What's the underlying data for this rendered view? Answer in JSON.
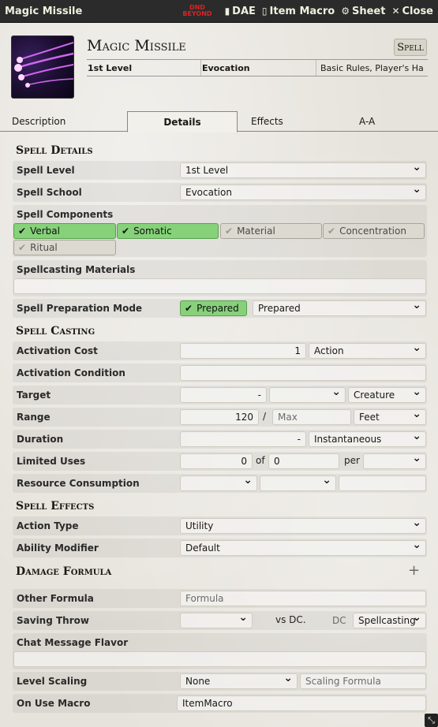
{
  "window": {
    "title": "Magic Missile",
    "ddb_line1": "DND",
    "ddb_line2": "BEYOND",
    "dae_label": "DAE",
    "item_macro_label": "Item Macro",
    "sheet_label": "Sheet",
    "close_label": "Close"
  },
  "header": {
    "name": "Magic Missile",
    "type_badge": "Spell",
    "level": "1st Level",
    "school": "Evocation",
    "source": "Basic Rules, Player's Ha"
  },
  "tabs": [
    {
      "label": "Description"
    },
    {
      "label": "Details"
    },
    {
      "label": "Effects"
    },
    {
      "label": "A-A"
    }
  ],
  "details": {
    "h_spell_details": "Spell Details",
    "spell_level_label": "Spell Level",
    "spell_level_value": "1st Level",
    "spell_school_label": "Spell School",
    "spell_school_value": "Evocation",
    "components_label": "Spell Components",
    "components": {
      "verbal": "Verbal",
      "somatic": "Somatic",
      "material": "Material",
      "concentration": "Concentration",
      "ritual": "Ritual"
    },
    "materials_label": "Spellcasting Materials",
    "materials_value": "",
    "prep_label": "Spell Preparation Mode",
    "prep_check": "Prepared",
    "prep_mode": "Prepared",
    "h_spell_casting": "Spell Casting",
    "activation_cost_label": "Activation Cost",
    "activation_cost_value": "1",
    "activation_type": "Action",
    "activation_condition_label": "Activation Condition",
    "activation_condition_value": "",
    "target_label": "Target",
    "target_value": "-",
    "target_units": "",
    "target_type": "Creature",
    "range_label": "Range",
    "range_value": "120",
    "range_sep": "/",
    "range_max_placeholder": "Max",
    "range_units": "Feet",
    "duration_label": "Duration",
    "duration_value": "-",
    "duration_units": "Instantaneous",
    "limited_uses_label": "Limited Uses",
    "uses_value": "0",
    "uses_of": "of",
    "uses_max": "0",
    "uses_per": "per",
    "uses_period": "",
    "resource_label": "Resource Consumption",
    "h_spell_effects": "Spell Effects",
    "action_type_label": "Action Type",
    "action_type_value": "Utility",
    "ability_mod_label": "Ability Modifier",
    "ability_mod_value": "Default",
    "h_damage_formula": "Damage Formula",
    "add_damage": "+",
    "other_formula_label": "Other Formula",
    "other_formula_placeholder": "Formula",
    "saving_throw_label": "Saving Throw",
    "saving_throw_value": "",
    "vs_dc": "vs DC.",
    "dc_placeholder": "DC",
    "dc_scaling": "Spellcasting",
    "chat_flavor_label": "Chat Message Flavor",
    "chat_flavor_value": "",
    "level_scaling_label": "Level Scaling",
    "level_scaling_value": "None",
    "scaling_formula_placeholder": "Scaling Formula",
    "on_use_macro_label": "On Use Macro",
    "on_use_macro_value": "ItemMacro"
  },
  "colors": {
    "header_bg": "#2b2b2b",
    "checked_green": "#86d17a",
    "ddb_red": "#dd2222"
  },
  "icons": [
    "dnd-beyond-logo-icon",
    "file-icon",
    "scroll-icon",
    "gear-icon",
    "close-icon",
    "check-icon",
    "plus-icon",
    "chevron-down-icon",
    "resize-icon"
  ]
}
